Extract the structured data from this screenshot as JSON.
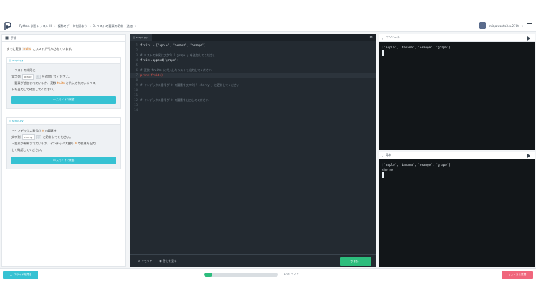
{
  "header": {
    "breadcrumbs": [
      "Python 学習レッスン III",
      "複数のデータを扱おう",
      "3. リストの要素の更新・追加"
    ],
    "user_name": "miojawanto3.u.270t"
  },
  "left": {
    "title": "手順",
    "intro_before": "すでに変数 ",
    "intro_var": "fruits",
    "intro_after": " にリストが代入されています。",
    "cards": [
      {
        "file": "script.py",
        "line1": "・リストの末尾に",
        "line2_prefix": "文字列 ",
        "chip": "grape",
        "copy": "ⓒ",
        "line2_suffix": " を追加してください。",
        "line3_a": "・要素が追加されているか、変数 ",
        "line3_var": "fruits",
        "line3_b": " に代入されているリス",
        "line4": "トを出力して確認してください。",
        "button": "スライドで確認"
      },
      {
        "file": "script.py",
        "line1_a": "・インデックス番号が ",
        "line1_num": "0",
        "line1_b": " の要素を",
        "line2_prefix": "文字列 ",
        "chip": "cherry",
        "copy": "ⓒ",
        "line2_suffix": " に更新してください。",
        "line3_a": "・要素が更新されているか、インデックス番号 ",
        "line3_num": "0",
        "line3_b": " の要素を出力",
        "line4": "して確認してください。",
        "button": "スライドで確認"
      }
    ]
  },
  "editor": {
    "tab": "script.py",
    "lines": [
      {
        "n": "1",
        "t": "fruits = ['apple', 'banana', 'orange']"
      },
      {
        "n": "2",
        "t": ""
      },
      {
        "n": "3",
        "t": "# リストの末尾に文字列「 grape 」を追加してください"
      },
      {
        "n": "4",
        "t": "fruits.append('grape')"
      },
      {
        "n": "5",
        "t": ""
      },
      {
        "n": "6",
        "t": "# 変数 fruits に代入したリストを出力してください"
      },
      {
        "n": "7",
        "t": "print(fruits)"
      },
      {
        "n": "8",
        "t": ""
      },
      {
        "n": "9",
        "t": "# インデックス番号が 0 の要素を文字列「 cherry 」に更新してください"
      },
      {
        "n": "10",
        "t": ""
      },
      {
        "n": "11",
        "t": ""
      },
      {
        "n": "12",
        "t": "# インデックス番号が 0 の要素を出力してください"
      },
      {
        "n": "13",
        "t": ""
      },
      {
        "n": "14",
        "t": ""
      }
    ],
    "reset_label": "リセット",
    "answer_label": "答えを見る",
    "run_label": "できた！"
  },
  "console": {
    "title": "コンソール",
    "output": "['apple', 'banana', 'orange', 'grape']"
  },
  "sample": {
    "title": "見本",
    "output_line1": "['apple', 'banana', 'orange', 'grape']",
    "output_line2": "cherry"
  },
  "footer": {
    "slide_button": "スライドを見る",
    "progress": 0.12,
    "progress_text": "1/16 クリア",
    "faq_button": "よくある質問"
  }
}
